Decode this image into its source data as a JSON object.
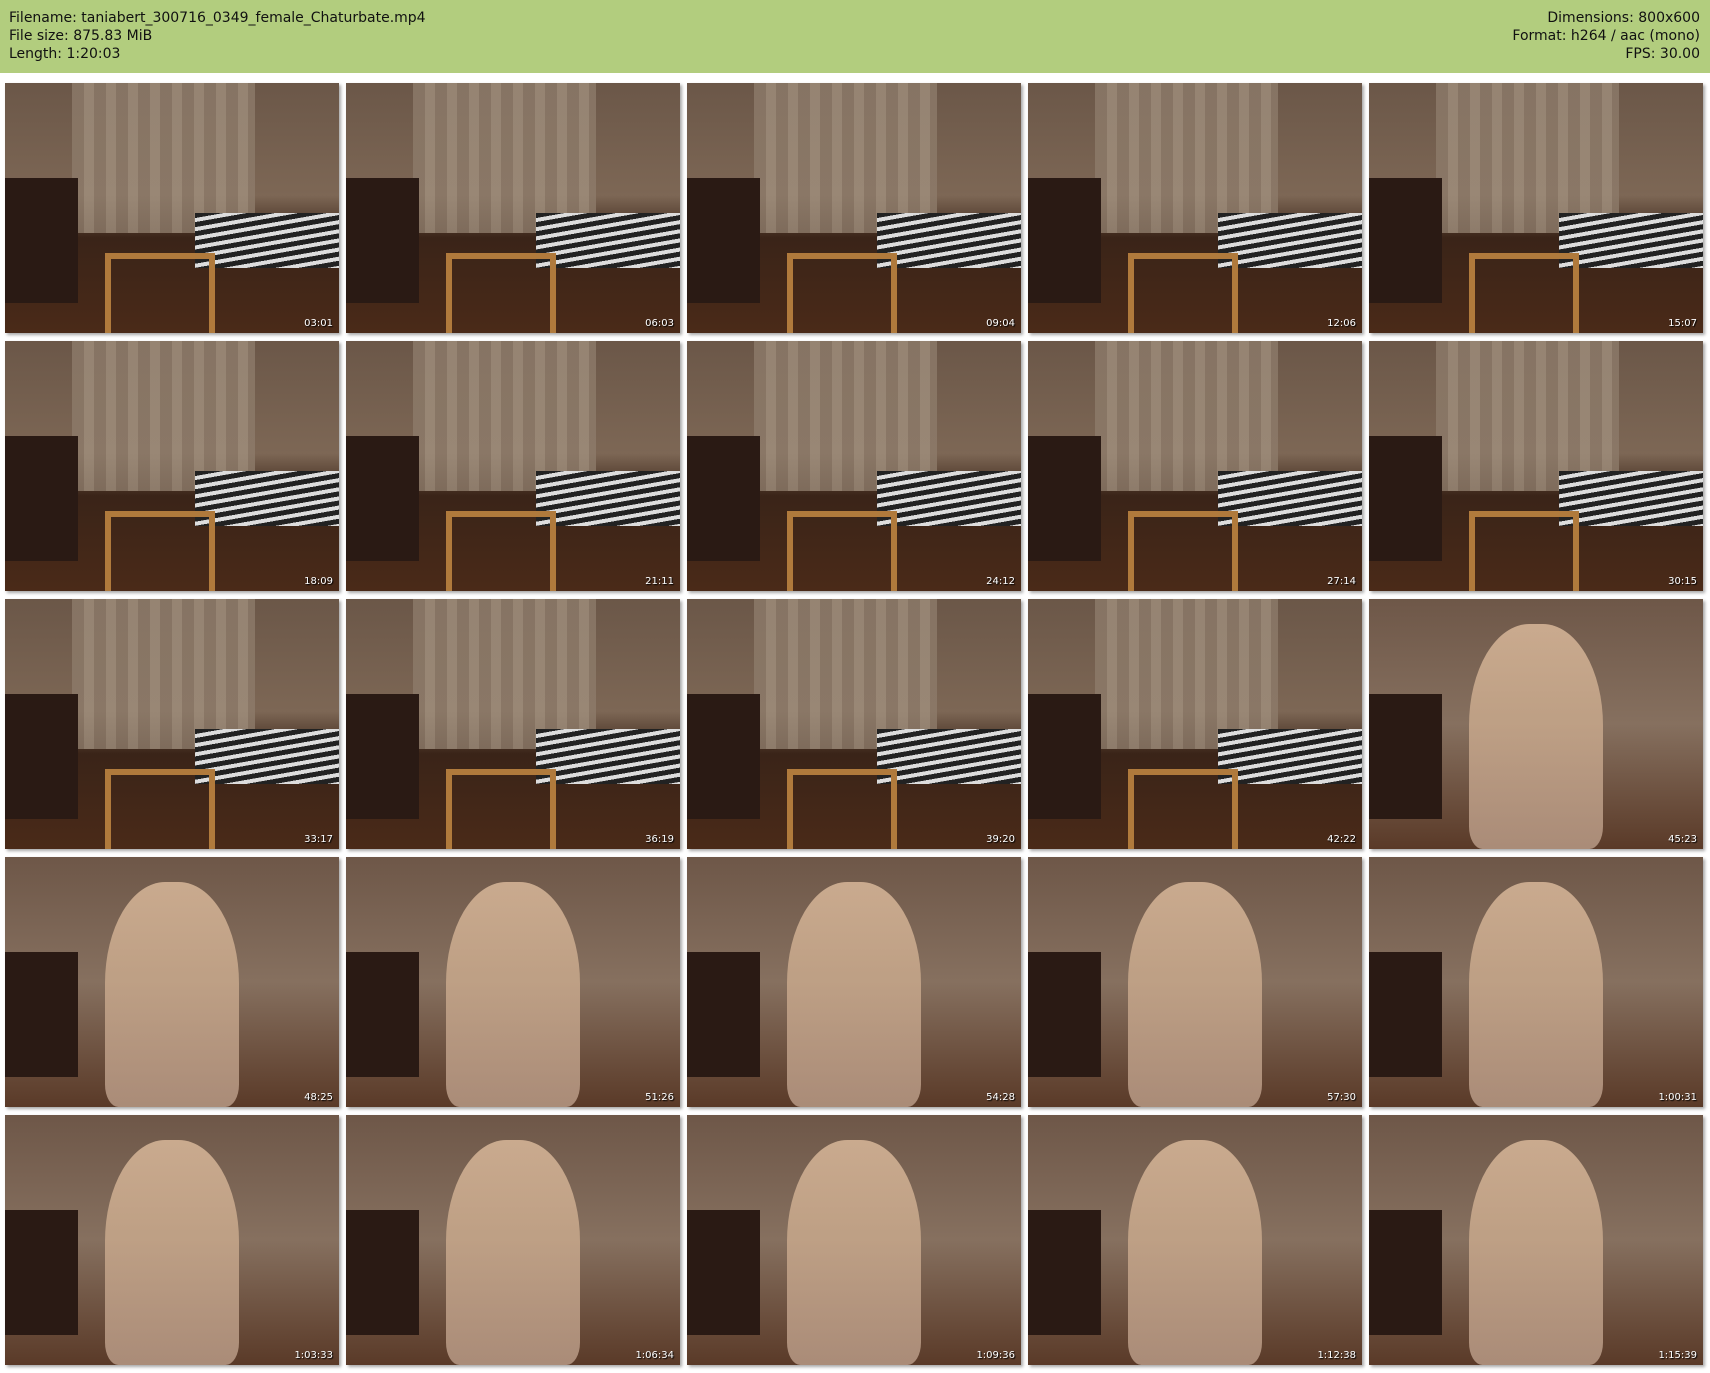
{
  "header": {
    "filename": "Filename: taniabert_300716_0349_female_Chaturbate.mp4",
    "filesize": "File size: 875.83 MiB",
    "length": "Length: 1:20:03",
    "dimensions": "Dimensions: 800x600",
    "format": "Format: h264 / aac (mono)",
    "fps": "FPS: 30.00"
  },
  "colors": {
    "header_bg": "#b2cd7e"
  },
  "thumbnails": [
    {
      "time": "03:01",
      "scene": "room"
    },
    {
      "time": "06:03",
      "scene": "room"
    },
    {
      "time": "09:04",
      "scene": "room"
    },
    {
      "time": "12:06",
      "scene": "room"
    },
    {
      "time": "15:07",
      "scene": "room"
    },
    {
      "time": "18:09",
      "scene": "room"
    },
    {
      "time": "21:11",
      "scene": "room"
    },
    {
      "time": "24:12",
      "scene": "room"
    },
    {
      "time": "27:14",
      "scene": "room"
    },
    {
      "time": "30:15",
      "scene": "room"
    },
    {
      "time": "33:17",
      "scene": "room"
    },
    {
      "time": "36:19",
      "scene": "room"
    },
    {
      "time": "39:20",
      "scene": "room"
    },
    {
      "time": "42:22",
      "scene": "room"
    },
    {
      "time": "45:23",
      "scene": "person"
    },
    {
      "time": "48:25",
      "scene": "person"
    },
    {
      "time": "51:26",
      "scene": "person"
    },
    {
      "time": "54:28",
      "scene": "person"
    },
    {
      "time": "57:30",
      "scene": "person"
    },
    {
      "time": "1:00:31",
      "scene": "person"
    },
    {
      "time": "1:03:33",
      "scene": "person"
    },
    {
      "time": "1:06:34",
      "scene": "person"
    },
    {
      "time": "1:09:36",
      "scene": "person"
    },
    {
      "time": "1:12:38",
      "scene": "person"
    },
    {
      "time": "1:15:39",
      "scene": "person"
    }
  ]
}
